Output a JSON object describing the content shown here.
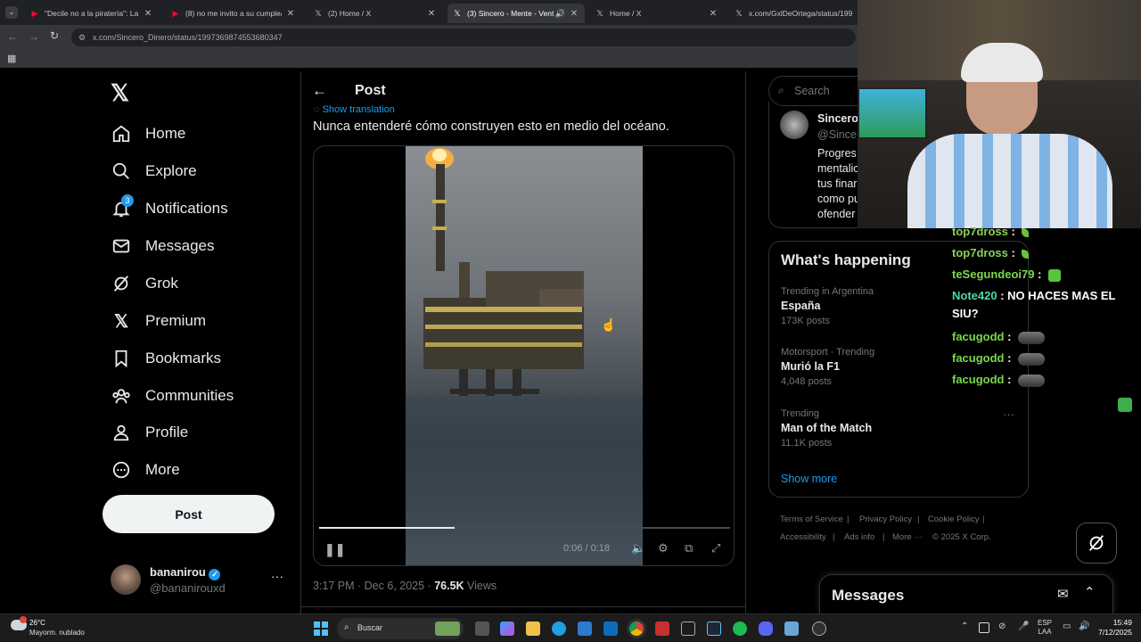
{
  "browser": {
    "tabs": [
      {
        "title": "\"Decile no a la piratería\": La insu",
        "icon": "youtube-icon",
        "color": "#ff0033"
      },
      {
        "title": "(8) no me invito a su cumpleaño",
        "icon": "youtube-icon",
        "color": "#ff0033"
      },
      {
        "title": "(2) Home / X",
        "icon": "x-logo-icon",
        "color": "#ffffff"
      },
      {
        "title": "(3) Sincero - Mente - Venta",
        "icon": "x-logo-icon",
        "color": "#ffffff"
      },
      {
        "title": "Home / X",
        "icon": "x-logo-icon",
        "color": "#ffffff"
      },
      {
        "title": "x.com/GxlDeOrtega/status/199",
        "icon": "x-logo-icon",
        "color": "#ffffff"
      }
    ],
    "url": "x.com/Sincero_Dinero/status/1997369874553680347"
  },
  "nav": {
    "items": [
      {
        "label": "Home",
        "icon": "home-icon"
      },
      {
        "label": "Explore",
        "icon": "search-icon"
      },
      {
        "label": "Notifications",
        "icon": "bell-icon",
        "badge": "3"
      },
      {
        "label": "Messages",
        "icon": "envelope-icon"
      },
      {
        "label": "Grok",
        "icon": "grok-icon"
      },
      {
        "label": "Premium",
        "icon": "x-logo-icon"
      },
      {
        "label": "Bookmarks",
        "icon": "bookmark-icon"
      },
      {
        "label": "Communities",
        "icon": "communities-icon"
      },
      {
        "label": "Profile",
        "icon": "person-icon"
      },
      {
        "label": "More",
        "icon": "more-circle-icon"
      }
    ],
    "post_label": "Post",
    "account": {
      "name": "bananirou",
      "handle": "@bananirouxd"
    }
  },
  "post": {
    "header_title": "Post",
    "show_translation": "Show translation",
    "text": "Nunca entenderé cómo construyen esto en medio del océano.",
    "video": {
      "time": "0:06 / 0:18",
      "progress": 0.33
    },
    "timestamp": "3:17 PM · Dec 6, 2025 · ",
    "views_count": "76.5K",
    "views_label": " Views"
  },
  "right": {
    "search_placeholder": "Search",
    "profile_card": {
      "name": "Sincero",
      "handle": "@Sincer",
      "bio_lines": [
        "Progres",
        "mentalic",
        "tus finar",
        "como pu",
        "ofender"
      ]
    },
    "whats_happening": {
      "title": "What's happening",
      "trends": [
        {
          "meta": "Trending in Argentina",
          "title": "España",
          "count": "173K posts"
        },
        {
          "meta": "Motorsport · Trending",
          "title": "Murió la F1",
          "count": "4,048 posts"
        },
        {
          "meta": "Trending",
          "title": "Man of the Match",
          "count": "11.1K posts"
        }
      ],
      "show_more": "Show more"
    },
    "footer": {
      "links_row1": [
        "Terms of Service",
        "Privacy Policy",
        "Cookie Policy"
      ],
      "links_row2": [
        "Accessibility",
        "Ads info",
        "More ···"
      ],
      "copyright": "© 2025 X Corp."
    },
    "messages_label": "Messages"
  },
  "chat": {
    "lines": [
      {
        "user": "top7dross",
        "text": "",
        "color": "#8ecf5a"
      },
      {
        "user": "top7dross",
        "text": "",
        "color": "#8ecf5a"
      },
      {
        "user": "teSegundeoi79",
        "text": "",
        "color": "#7ad84c"
      },
      {
        "user": "Note420",
        "text": "NO HACES MAS EL SIU?",
        "color": "#4fd6a6"
      },
      {
        "user": "facugodd",
        "text": "",
        "color": "#7ad84c"
      },
      {
        "user": "facugodd",
        "text": "",
        "color": "#7ad84c"
      },
      {
        "user": "facugodd",
        "text": "",
        "color": "#7ad84c"
      }
    ]
  },
  "taskbar": {
    "weather_temp": "26°C",
    "weather_desc": "Mayorm. nublado",
    "search_label": "Buscar",
    "lang": "ESP",
    "lang_sub": "LAA",
    "time": "15:49",
    "date": "7/12/2025"
  },
  "colors": {
    "accent": "#1d9bf0",
    "bg": "#000000",
    "border": "#2f3336",
    "muted": "#71767b"
  }
}
